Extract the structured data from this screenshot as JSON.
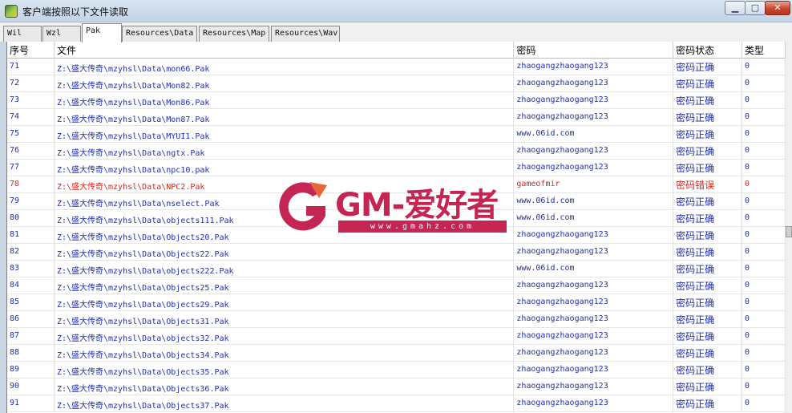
{
  "window": {
    "title": "客户端按照以下文件读取",
    "buttons": {
      "minimize": "▁",
      "maximize": "▢",
      "close": "✕"
    }
  },
  "tabs": [
    {
      "label": "Wil",
      "active": false
    },
    {
      "label": "Wzl",
      "active": false
    },
    {
      "label": "Pak",
      "active": true
    },
    {
      "label": "Resources\\Data",
      "active": false
    },
    {
      "label": "Resources\\Map",
      "active": false
    },
    {
      "label": "Resources\\Wav",
      "active": false
    }
  ],
  "columns": [
    "序号",
    "文件",
    "密码",
    "密码状态",
    "类型"
  ],
  "rows": [
    {
      "id": "71",
      "file": "Z:\\盛大传奇\\mzyhsl\\Data\\mon66.Pak",
      "password": "zhaogangzhaogang123",
      "status": "密码正确",
      "type": "0",
      "error": false
    },
    {
      "id": "72",
      "file": "Z:\\盛大传奇\\mzyhsl\\Data\\Mon82.Pak",
      "password": "zhaogangzhaogang123",
      "status": "密码正确",
      "type": "0",
      "error": false
    },
    {
      "id": "73",
      "file": "Z:\\盛大传奇\\mzyhsl\\Data\\Mon86.Pak",
      "password": "zhaogangzhaogang123",
      "status": "密码正确",
      "type": "0",
      "error": false
    },
    {
      "id": "74",
      "file": "Z:\\盛大传奇\\mzyhsl\\Data\\Mon87.Pak",
      "password": "zhaogangzhaogang123",
      "status": "密码正确",
      "type": "0",
      "error": false
    },
    {
      "id": "75",
      "file": "Z:\\盛大传奇\\mzyhsl\\Data\\MYUI1.Pak",
      "password": "www.06id.com",
      "status": "密码正确",
      "type": "0",
      "error": false
    },
    {
      "id": "76",
      "file": "Z:\\盛大传奇\\mzyhsl\\Data\\ngtx.Pak",
      "password": "zhaogangzhaogang123",
      "status": "密码正确",
      "type": "0",
      "error": false
    },
    {
      "id": "77",
      "file": "Z:\\盛大传奇\\mzyhsl\\Data\\npc10.pak",
      "password": "zhaogangzhaogang123",
      "status": "密码正确",
      "type": "0",
      "error": false
    },
    {
      "id": "78",
      "file": "Z:\\盛大传奇\\mzyhsl\\Data\\NPC2.Pak",
      "password": "gameofmir",
      "status": "密码错误",
      "type": "0",
      "error": true
    },
    {
      "id": "79",
      "file": "Z:\\盛大传奇\\mzyhsl\\Data\\nselect.Pak",
      "password": "www.06id.com",
      "status": "密码正确",
      "type": "0",
      "error": false
    },
    {
      "id": "80",
      "file": "Z:\\盛大传奇\\mzyhsl\\Data\\objects111.Pak",
      "password": "www.06id.com",
      "status": "密码正确",
      "type": "0",
      "error": false
    },
    {
      "id": "81",
      "file": "Z:\\盛大传奇\\mzyhsl\\Data\\Objects20.Pak",
      "password": "zhaogangzhaogang123",
      "status": "密码正确",
      "type": "0",
      "error": false
    },
    {
      "id": "82",
      "file": "Z:\\盛大传奇\\mzyhsl\\Data\\Objects22.Pak",
      "password": "zhaogangzhaogang123",
      "status": "密码正确",
      "type": "0",
      "error": false
    },
    {
      "id": "83",
      "file": "Z:\\盛大传奇\\mzyhsl\\Data\\objects222.Pak",
      "password": "www.06id.com",
      "status": "密码正确",
      "type": "0",
      "error": false
    },
    {
      "id": "84",
      "file": "Z:\\盛大传奇\\mzyhsl\\Data\\Objects25.Pak",
      "password": "zhaogangzhaogang123",
      "status": "密码正确",
      "type": "0",
      "error": false
    },
    {
      "id": "85",
      "file": "Z:\\盛大传奇\\mzyhsl\\Data\\Objects29.Pak",
      "password": "zhaogangzhaogang123",
      "status": "密码正确",
      "type": "0",
      "error": false
    },
    {
      "id": "86",
      "file": "Z:\\盛大传奇\\mzyhsl\\Data\\Objects31.Pak",
      "password": "zhaogangzhaogang123",
      "status": "密码正确",
      "type": "0",
      "error": false
    },
    {
      "id": "87",
      "file": "Z:\\盛大传奇\\mzyhsl\\Data\\objects32.Pak",
      "password": "zhaogangzhaogang123",
      "status": "密码正确",
      "type": "0",
      "error": false
    },
    {
      "id": "88",
      "file": "Z:\\盛大传奇\\mzyhsl\\Data\\Objects34.Pak",
      "password": "zhaogangzhaogang123",
      "status": "密码正确",
      "type": "0",
      "error": false
    },
    {
      "id": "89",
      "file": "Z:\\盛大传奇\\mzyhsl\\Data\\Objects35.Pak",
      "password": "zhaogangzhaogang123",
      "status": "密码正确",
      "type": "0",
      "error": false
    },
    {
      "id": "90",
      "file": "Z:\\盛大传奇\\mzyhsl\\Data\\Objects36.Pak",
      "password": "zhaogangzhaogang123",
      "status": "密码正确",
      "type": "0",
      "error": false
    },
    {
      "id": "91",
      "file": "Z:\\盛大传奇\\mzyhsl\\Data\\Objects37.Pak",
      "password": "zhaogangzhaogang123",
      "status": "密码正确",
      "type": "0",
      "error": false
    }
  ],
  "watermark": {
    "text": "GM-爱好者",
    "url": "www.gmahz.com",
    "color": "#c42552"
  },
  "colors": {
    "text_ok": "#1f2fb0",
    "text_error": "#d9261c"
  }
}
